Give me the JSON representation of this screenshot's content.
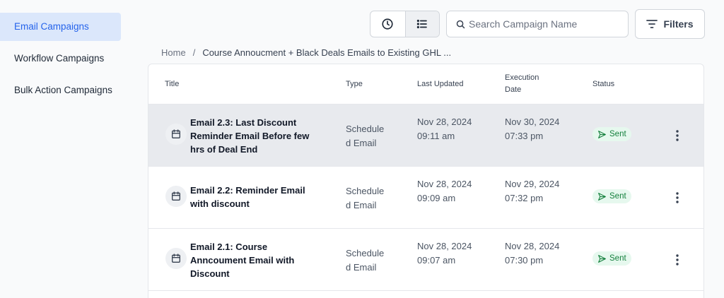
{
  "sidebar": {
    "items": [
      {
        "label": "Email Campaigns"
      },
      {
        "label": "Workflow Campaigns"
      },
      {
        "label": "Bulk Action Campaigns"
      }
    ]
  },
  "toolbar": {
    "search_placeholder": "Search Campaign Name",
    "filters_label": "Filters"
  },
  "breadcrumb": {
    "home": "Home",
    "separator": "/",
    "current": "Course Annoucment + Black Deals Emails to Existing GHL ..."
  },
  "table": {
    "columns": {
      "title": "Title",
      "type": "Type",
      "last_updated": "Last Updated",
      "execution_date": "Execution Date",
      "status": "Status"
    },
    "rows": [
      {
        "title": "Email 2.3: Last Discount Reminder Email Before few hrs of Deal End",
        "type": "Scheduled Email",
        "last_updated": "Nov 28, 2024 09:11 am",
        "execution_date": "Nov 30, 2024 07:33 pm",
        "status": "Sent"
      },
      {
        "title": "Email 2.2: Reminder Email with discount",
        "type": "Scheduled Email",
        "last_updated": "Nov 28, 2024 09:09 am",
        "execution_date": "Nov 29, 2024 07:32 pm",
        "status": "Sent"
      },
      {
        "title": "Email 2.1: Course Anncoument Email with Discount",
        "type": "Scheduled Email",
        "last_updated": "Nov 28, 2024 09:07 am",
        "execution_date": "Nov 28, 2024 07:30 pm",
        "status": "Sent"
      }
    ]
  },
  "colors": {
    "accent": "#2563eb",
    "active_nav_bg": "#dbe7fb",
    "status_sent": "#15803d",
    "status_sent_bg": "#e6f8ee"
  }
}
